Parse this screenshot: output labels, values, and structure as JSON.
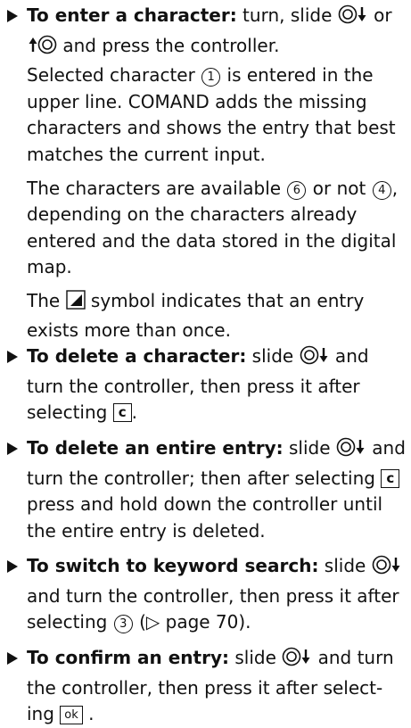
{
  "enter": {
    "lead": "To enter a character:",
    "t1": " turn, slide ",
    "t2": " or ",
    "t3": " and press the controller.",
    "p1a": "Selected character ",
    "p1_num": "1",
    "p1b": " is entered in the upper line. COMAND adds the missing characters and shows the entry that best matches the current input.",
    "p2a": "The characters are available ",
    "p2_num1": "6",
    "p2b": " or not ",
    "p2_num2": "4",
    "p2c": ", depending on the characters already entered and the data stored in the digital map.",
    "p3a": "The ",
    "p3b": " symbol indicates that an entry exists more than once."
  },
  "delete_char": {
    "lead": "To delete a character:",
    "t1": " slide ",
    "t2": " and turn the controller, then press it after selecting ",
    "key": "c",
    "t3": "."
  },
  "delete_entry": {
    "lead": "To delete an entire entry:",
    "t1": " slide ",
    "t2": " and turn the controller; then after selecting ",
    "key": "c",
    "t3": " press and hold down the controller until the entire entry is deleted."
  },
  "keyword": {
    "lead": "To switch to keyword search:",
    "t1": " slide ",
    "t2": " and turn the controller, then press it after selecting ",
    "num": "3",
    "t3": " (▷ page 70)."
  },
  "confirm": {
    "lead": "To confirm an entry:",
    "t1": " slide ",
    "t2": " and turn the controller, then press it after select-ing ",
    "key": "ok",
    "t3": " ."
  }
}
